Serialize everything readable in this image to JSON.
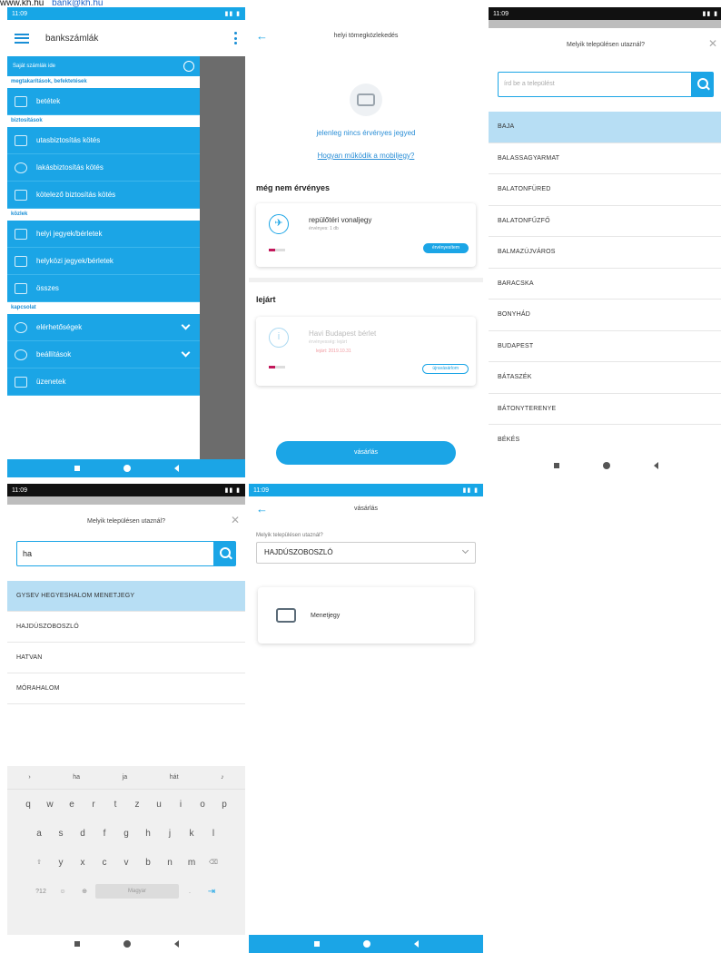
{
  "top_caption": {
    "site": "www.kh.hu",
    "email": "bank@kh.hu"
  },
  "status_time": "11:09",
  "screen_menu": {
    "app_title": "bankszámlák",
    "drawer_top": "Saját számlák ide",
    "sections": [
      {
        "label": "megtakarítások, befektetések",
        "items": [
          {
            "label": "betétek",
            "icon": "deposit-icon"
          }
        ]
      },
      {
        "label": "biztosítások",
        "items": [
          {
            "label": "utasbiztosítás kötés",
            "icon": "travel-insurance-icon"
          },
          {
            "label": "lakásbiztosítás kötés",
            "icon": "home-insurance-icon"
          },
          {
            "label": "kötelező biztosítás kötés",
            "icon": "car-insurance-icon"
          }
        ]
      },
      {
        "label": "közlek",
        "items": [
          {
            "label": "helyi jegyek/bérletek",
            "icon": "bus-icon"
          },
          {
            "label": "helyközi jegyek/bérletek",
            "icon": "coach-icon"
          },
          {
            "label": "összes",
            "icon": "all-icon"
          }
        ]
      },
      {
        "label": "kapcsolat",
        "items": [
          {
            "label": "elérhetőségek",
            "icon": "contact-icon",
            "expand": true
          },
          {
            "label": "beállítások",
            "icon": "gear-icon",
            "expand": true
          },
          {
            "label": "üzenetek",
            "icon": "mail-icon"
          }
        ]
      }
    ]
  },
  "screen_tickets": {
    "title": "helyi tömegközlekedés",
    "empty_text": "jelenleg nincs érvényes jegyed",
    "how_link": "Hogyan működik a mobiljegy?",
    "not_valid_heading": "még nem érvényes",
    "ticket1": {
      "name": "repülőtéri vonaljegy",
      "sub": "érvényes: 1 db",
      "button": "érvényesítem"
    },
    "expired_heading": "lejárt",
    "ticket2": {
      "name": "Havi Budapest bérlet",
      "sub": "érvényesség: lejárt",
      "red": "lejárt: 2019.10.31",
      "button": "újravásárlom"
    },
    "buy_button": "vásárlás"
  },
  "screen_city_list": {
    "title": "Melyik településen utaznál?",
    "placeholder": "írd be a települést",
    "cities": [
      "BAJA",
      "BALASSAGYARMAT",
      "BALATONFÜRED",
      "BALATONFŰZFŐ",
      "BALMAZÚJVÁROS",
      "BARACSKA",
      "BONYHÁD",
      "BUDAPEST",
      "BÁTASZÉK",
      "BÁTONYTERENYE",
      "BÉKÉS"
    ]
  },
  "screen_city_search": {
    "title": "Melyik településen utaznál?",
    "query": "ha",
    "results": [
      "GYSEV HEGYESHALOM MENETJEGY",
      "HAJDÚSZOBOSZLÓ",
      "HATVAN",
      "MÓRAHALOM"
    ],
    "keyboard": {
      "suggestions": [
        "ha",
        "ja",
        "hát"
      ],
      "row1": [
        "q",
        "w",
        "e",
        "r",
        "t",
        "z",
        "u",
        "i",
        "o",
        "p"
      ],
      "row2": [
        "a",
        "s",
        "d",
        "f",
        "g",
        "h",
        "j",
        "k",
        "l"
      ],
      "row3": [
        "y",
        "x",
        "c",
        "v",
        "b",
        "n",
        "m"
      ],
      "space": "Magyar"
    }
  },
  "screen_purchase": {
    "title": "vásárlás",
    "field_label": "Melyik településen utaznál?",
    "selected_city": "HAJDÚSZOBOSZLÓ",
    "product": "Menetjegy"
  }
}
